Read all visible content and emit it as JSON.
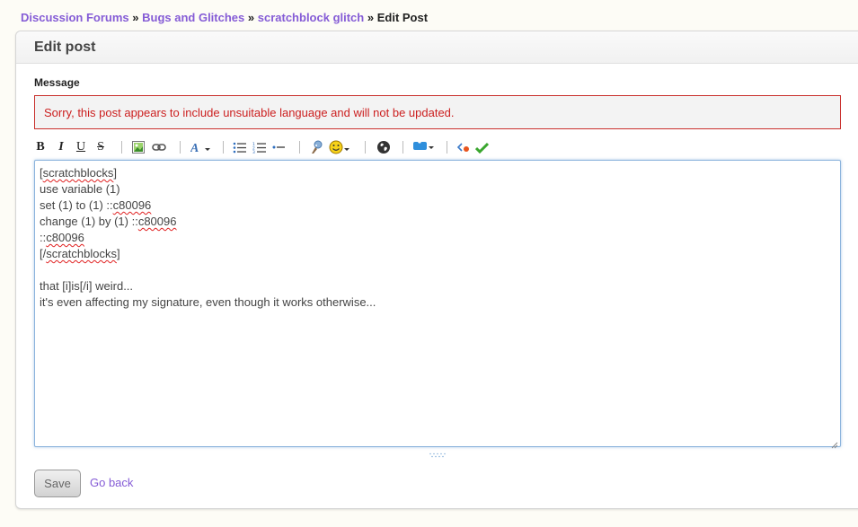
{
  "breadcrumb": {
    "items": [
      "Discussion Forums",
      "Bugs and Glitches",
      "scratchblock glitch"
    ],
    "separator": "»",
    "current": "Edit Post"
  },
  "panel": {
    "title": "Edit post"
  },
  "form": {
    "message_label": "Message",
    "error": "Sorry, this post appears to include unsuitable language and will not be updated.",
    "toolbar": {
      "bold": "B",
      "italic": "I",
      "underline": "U",
      "strike": "S",
      "icons": [
        "bold-icon",
        "italic-icon",
        "underline-icon",
        "strikethrough-icon",
        "image-icon",
        "link-icon",
        "font-color-icon",
        "bullet-list-icon",
        "numbered-list-icon",
        "list-item-icon",
        "quote-icon",
        "smiley-icon",
        "globe-icon",
        "scratch-blocks-icon",
        "preview-icon",
        "check-icon"
      ]
    },
    "editor_lines": [
      [
        "[",
        "scratchblocks",
        "]"
      ],
      [
        "use variable (1)"
      ],
      [
        "set (1) to (1) ::",
        "c80096"
      ],
      [
        "change (1) by (1) ::",
        "c80096"
      ],
      [
        "::",
        "c80096"
      ],
      [
        "[/",
        "scratchblocks",
        "]"
      ],
      [
        ""
      ],
      [
        "that [i]is[/i] weird..."
      ],
      [
        "it's even affecting my signature, even though it works otherwise..."
      ]
    ],
    "save_label": "Save",
    "go_back_label": "Go back"
  },
  "colors": {
    "link": "#855cd6",
    "error": "#cc1f1f",
    "editor_border": "#8cb4dc"
  }
}
